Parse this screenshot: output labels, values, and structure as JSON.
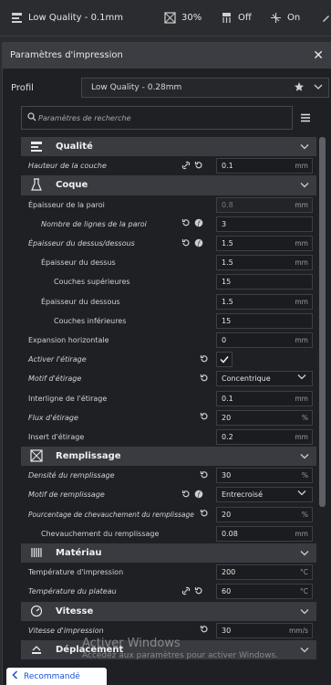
{
  "topbar": {
    "profile": "Low Quality - 0.1mm",
    "infill": "30%",
    "support": "Off",
    "adhesion": "On"
  },
  "panel": {
    "title": "Paramètres d'impression",
    "profil_label": "Profil",
    "profil_value": "Low Quality - 0.28mm",
    "search_placeholder": "Paramètres de recherche"
  },
  "settings": {
    "cat_qualite": "Qualité",
    "hauteur_couche": {
      "label": "Hauteur de la couche",
      "value": "0.1",
      "unit": "mm"
    },
    "cat_coque": "Coque",
    "epaisseur_paroi": {
      "label": "Épaisseur de la paroi",
      "value": "0.8",
      "unit": "mm"
    },
    "nb_lignes_paroi": {
      "label": "Nombre de lignes de la paroi",
      "value": "3"
    },
    "epaisseur_dessus_dessous": {
      "label": "Épaisseur du dessus/dessous",
      "value": "1.5",
      "unit": "mm"
    },
    "epaisseur_dessus": {
      "label": "Épaisseur du dessus",
      "value": "1.5",
      "unit": "mm"
    },
    "couches_sup": {
      "label": "Couches supérieures",
      "value": "15"
    },
    "epaisseur_dessous": {
      "label": "Épaisseur du dessous",
      "value": "1.5",
      "unit": "mm"
    },
    "couches_inf": {
      "label": "Couches inférieures",
      "value": "15"
    },
    "expansion_horizontale": {
      "label": "Expansion horizontale",
      "value": "0",
      "unit": "mm"
    },
    "activer_etirage": {
      "label": "Activer l'étirage"
    },
    "motif_etirage": {
      "label": "Motif d'étirage",
      "value": "Concentrique"
    },
    "interligne_etirage": {
      "label": "Interligne de l'étirage",
      "value": "0.1",
      "unit": "mm"
    },
    "flux_etirage": {
      "label": "Flux d'étirage",
      "value": "20",
      "unit": "%"
    },
    "insert_etirage": {
      "label": "Insert d'étirage",
      "value": "0.2",
      "unit": "mm"
    },
    "cat_remplissage": "Remplissage",
    "densite_remplissage": {
      "label": "Densité du remplissage",
      "value": "30",
      "unit": "%"
    },
    "motif_remplissage": {
      "label": "Motif de remplissage",
      "value": "Entrecroisé"
    },
    "pourcentage_chevauchement": {
      "label": "Pourcentage de chevauchement du remplissage",
      "value": "20",
      "unit": "%"
    },
    "chevauchement_remplissage": {
      "label": "Chevauchement du remplissage",
      "value": "0.08",
      "unit": "mm"
    },
    "cat_materiau": "Matériau",
    "temperature_impression": {
      "label": "Température d'impression",
      "value": "200",
      "unit": "°C"
    },
    "temperature_plateau": {
      "label": "Température du plateau",
      "value": "60",
      "unit": "°C"
    },
    "cat_vitesse": "Vitesse",
    "vitesse_impression": {
      "label": "Vitesse d'impression",
      "value": "30",
      "unit": "mm/s"
    },
    "cat_deplacement": "Déplacement"
  },
  "watermark": {
    "line1": "Activer Windows",
    "line2": "Accédez aux paramètres pour activer Windows."
  },
  "recommended_button": "Recommandé",
  "colors": {
    "panel_bg": "#1f2024",
    "category_bg": "#393b40",
    "link_blue": "#1a4fd6"
  }
}
